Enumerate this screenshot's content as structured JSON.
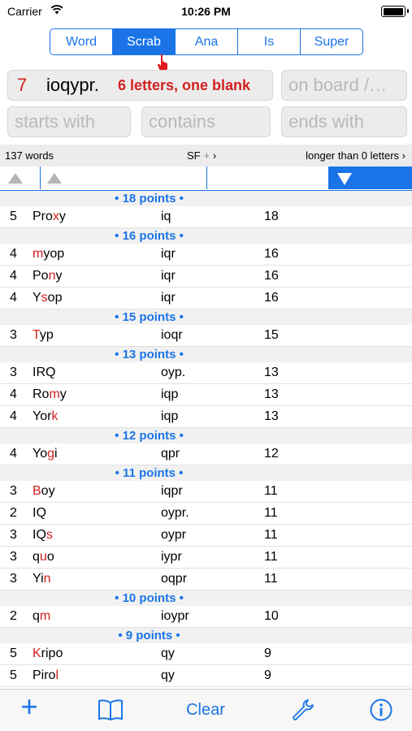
{
  "status": {
    "carrier": "Carrier",
    "time": "10:26 PM"
  },
  "modes": [
    "Word",
    "Scrab",
    "Ana",
    "Is",
    "Super"
  ],
  "active_mode": "Scrab",
  "query": {
    "count": "7",
    "letters": "ioqypr.",
    "hint": "6 letters,  one blank",
    "board_placeholder": "on board /…",
    "starts_placeholder": "starts with",
    "contains_placeholder": "contains",
    "ends_placeholder": "ends with"
  },
  "info": {
    "count": "137 words",
    "sort": "SF",
    "sort_plus": "+",
    "filter": "longer than 0 letters"
  },
  "toolbar": {
    "clear": "Clear"
  },
  "groups": [
    {
      "header": "• 18 points •",
      "rows": [
        {
          "len": "5",
          "word": [
            [
              "Pro",
              ""
            ],
            [
              "x",
              "r"
            ],
            [
              "y",
              ""
            ]
          ],
          "rack": "iq",
          "score": "18"
        }
      ]
    },
    {
      "header": "• 16 points •",
      "rows": [
        {
          "len": "4",
          "word": [
            [
              "m",
              "r"
            ],
            [
              "yop",
              ""
            ]
          ],
          "rack": "iqr",
          "score": "16"
        },
        {
          "len": "4",
          "word": [
            [
              "Po",
              ""
            ],
            [
              "n",
              "r"
            ],
            [
              "y",
              ""
            ]
          ],
          "rack": "iqr",
          "score": "16"
        },
        {
          "len": "4",
          "word": [
            [
              "Y",
              ""
            ],
            [
              "s",
              "r"
            ],
            [
              "op",
              ""
            ]
          ],
          "rack": "iqr",
          "score": "16"
        }
      ]
    },
    {
      "header": "• 15 points •",
      "rows": [
        {
          "len": "3",
          "word": [
            [
              "T",
              "r"
            ],
            [
              "yp",
              ""
            ]
          ],
          "rack": "ioqr",
          "score": "15"
        }
      ]
    },
    {
      "header": "• 13 points •",
      "rows": [
        {
          "len": "3",
          "word": [
            [
              "IRQ",
              ""
            ]
          ],
          "rack": "oyp.",
          "score": "13"
        },
        {
          "len": "4",
          "word": [
            [
              "Ro",
              ""
            ],
            [
              "m",
              "r"
            ],
            [
              "y",
              ""
            ]
          ],
          "rack": "iqp",
          "score": "13"
        },
        {
          "len": "4",
          "word": [
            [
              "Yor",
              ""
            ],
            [
              "k",
              "r"
            ]
          ],
          "rack": "iqp",
          "score": "13"
        }
      ]
    },
    {
      "header": "• 12 points •",
      "rows": [
        {
          "len": "4",
          "word": [
            [
              "Yo",
              ""
            ],
            [
              "g",
              "r"
            ],
            [
              "i",
              ""
            ]
          ],
          "rack": "qpr",
          "score": "12"
        }
      ]
    },
    {
      "header": "• 11 points •",
      "rows": [
        {
          "len": "3",
          "word": [
            [
              "B",
              "r"
            ],
            [
              "oy",
              ""
            ]
          ],
          "rack": "iqpr",
          "score": "11"
        },
        {
          "len": "2",
          "word": [
            [
              "IQ",
              ""
            ]
          ],
          "rack": "oypr.",
          "score": "11"
        },
        {
          "len": "3",
          "word": [
            [
              "IQ",
              ""
            ],
            [
              "s",
              "r"
            ]
          ],
          "rack": "oypr",
          "score": "11"
        },
        {
          "len": "3",
          "word": [
            [
              "q",
              ""
            ],
            [
              "u",
              "r"
            ],
            [
              "o",
              ""
            ]
          ],
          "rack": "iypr",
          "score": "11"
        },
        {
          "len": "3",
          "word": [
            [
              "Yi",
              ""
            ],
            [
              "n",
              "r"
            ]
          ],
          "rack": "oqpr",
          "score": "11"
        }
      ]
    },
    {
      "header": "• 10 points •",
      "rows": [
        {
          "len": "2",
          "word": [
            [
              "q",
              ""
            ],
            [
              "m",
              "r"
            ]
          ],
          "rack": "ioypr",
          "score": "10"
        }
      ]
    },
    {
      "header": "• 9 points •",
      "rows": [
        {
          "len": "5",
          "word": [
            [
              "K",
              "r"
            ],
            [
              "ripo",
              ""
            ]
          ],
          "rack": "qy",
          "score": "9"
        },
        {
          "len": "5",
          "word": [
            [
              "Piro",
              ""
            ],
            [
              "l",
              "r"
            ]
          ],
          "rack": "qy",
          "score": "9"
        }
      ]
    }
  ]
}
